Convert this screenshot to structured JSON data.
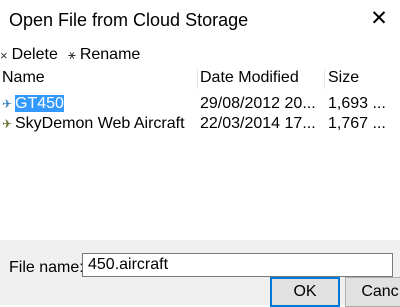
{
  "window": {
    "title": "Open File from Cloud Storage",
    "close_glyph": "✕"
  },
  "toolbar": {
    "delete_label": "Delete",
    "delete_icon": "×",
    "rename_label": "Rename",
    "rename_icon": "⚹"
  },
  "columns": {
    "name": "Name",
    "date": "Date Modified",
    "size": "Size"
  },
  "files": [
    {
      "name": "GT450",
      "date": "29/08/2012 20...",
      "size": "1,693 ...",
      "icon": "aircraft-icon",
      "selected": true
    },
    {
      "name": "SkyDemon Web Aircraft",
      "date": "22/03/2014 17...",
      "size": "1,767 ...",
      "icon": "aircraft-icon",
      "selected": false
    }
  ],
  "footer": {
    "filename_label": "File name:",
    "filename_value": "450.aircraft",
    "ok_label": "OK",
    "cancel_label": "Canc"
  },
  "colors": {
    "selection": "#3399ff",
    "accent": "#0078d7"
  }
}
